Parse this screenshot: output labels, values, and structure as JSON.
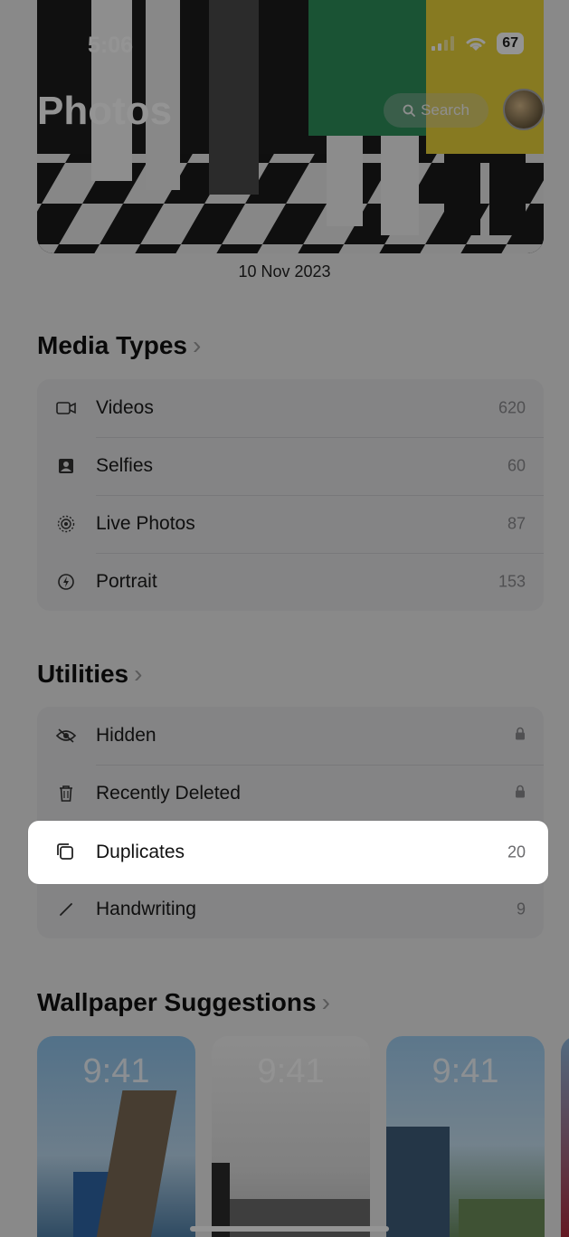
{
  "status": {
    "time": "5:06",
    "battery": "67"
  },
  "header": {
    "title": "Photos",
    "search_placeholder": "Search"
  },
  "hero": {
    "date": "10 Nov 2023"
  },
  "media_types": {
    "title": "Media Types",
    "items": [
      {
        "label": "Videos",
        "count": "620",
        "icon": "video-icon"
      },
      {
        "label": "Selfies",
        "count": "60",
        "icon": "selfie-icon"
      },
      {
        "label": "Live Photos",
        "count": "87",
        "icon": "live-photo-icon"
      },
      {
        "label": "Portrait",
        "count": "153",
        "icon": "portrait-icon"
      }
    ]
  },
  "utilities": {
    "title": "Utilities",
    "items": [
      {
        "label": "Hidden",
        "icon": "hidden-eye-icon",
        "trailing": "lock-icon"
      },
      {
        "label": "Recently Deleted",
        "icon": "trash-icon",
        "trailing": "lock-icon"
      },
      {
        "label": "Duplicates",
        "count": "20",
        "icon": "duplicates-icon"
      },
      {
        "label": "Handwriting",
        "count": "9",
        "icon": "handwriting-icon"
      }
    ]
  },
  "wallpapers": {
    "title": "Wallpaper Suggestions",
    "cards": [
      {
        "time": "9:41"
      },
      {
        "time": "9:41"
      },
      {
        "time": "9:41"
      }
    ]
  },
  "colors": {
    "highlight": "#ffffff",
    "dim": "rgba(0,0,0,0.42)"
  }
}
